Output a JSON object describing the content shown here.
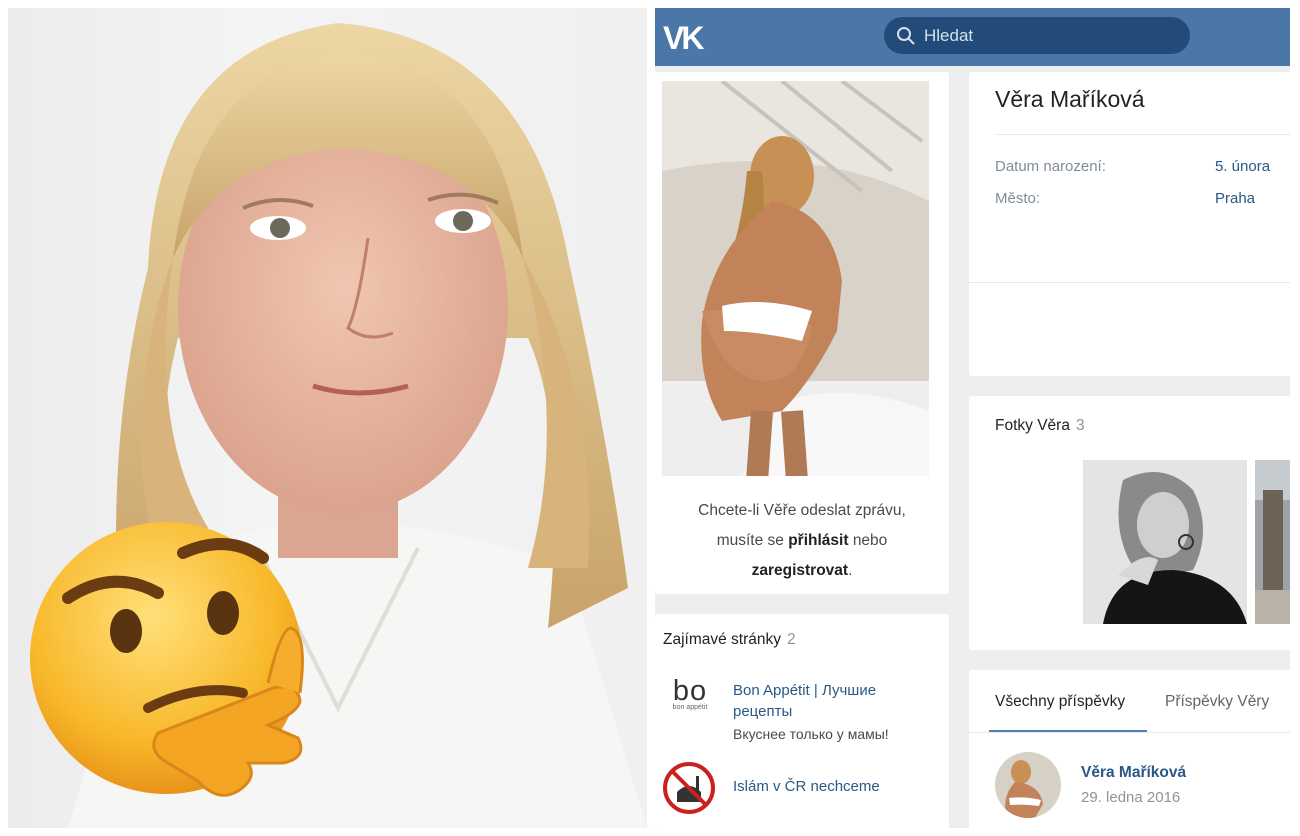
{
  "search": {
    "placeholder": "Hledat"
  },
  "profile": {
    "name": "Věra Maříková",
    "info": [
      {
        "label": "Datum narození:",
        "value": "5. února"
      },
      {
        "label": "Město:",
        "value": "Praha"
      }
    ]
  },
  "message": {
    "line1": "Chcete-li Věře odeslat zprávu,",
    "line2_prefix": "musíte se",
    "login_link": "přihlásit",
    "line2_mid": "nebo",
    "register_link": "zaregistrovat",
    "line3_suffix": "."
  },
  "pages_block": {
    "title": "Zajímavé stránky",
    "count": "2",
    "items": [
      {
        "title": "Bon Appétit | Лучшие рецепты",
        "description": "Вкуснее только у мамы!",
        "icon": "bon-appetit-logo-icon",
        "icon_text": "bo",
        "icon_subtext": "bon appétit"
      },
      {
        "title": "Islám v ČR nechceme",
        "icon": "no-mosque-icon"
      }
    ]
  },
  "photos_block": {
    "title": "Fotky Věra",
    "count": "3"
  },
  "wall": {
    "tabs": [
      {
        "label": "Všechny příspěvky",
        "active": true
      },
      {
        "label": "Příspěvky Věry",
        "active": false
      }
    ],
    "post": {
      "author": "Věra Maříková",
      "date": "29. ledna 2016"
    }
  },
  "colors": {
    "vk_header": "#4a76a8",
    "link": "#2a5885",
    "background": "#edeef0",
    "emoji_yellow": "#f7b628"
  },
  "icons": {
    "logo": "vk-logo-icon",
    "search": "search-icon",
    "emoji": "thinking-face-emoji"
  }
}
